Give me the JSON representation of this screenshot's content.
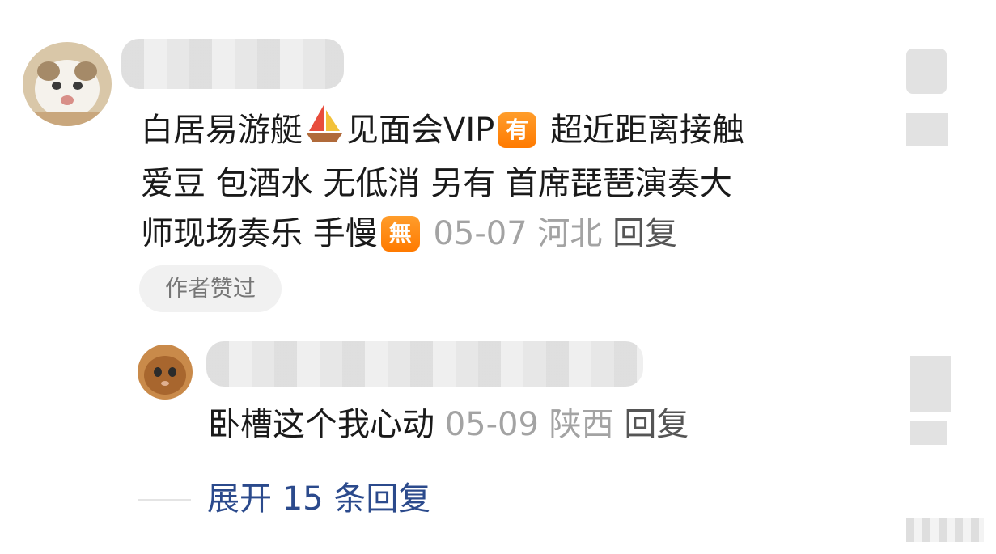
{
  "comment": {
    "segments_line1_a": "白居易游艇",
    "segments_line1_b": "见面会VIP",
    "badge_you": "有",
    "segments_line1_c": "  超近距离接触",
    "line2": "爱豆 包酒水 无低消  另有 首席琵琶演奏大",
    "line3": "师现场奏乐  手慢",
    "badge_wu": "無",
    "date": "05-07",
    "location": "河北",
    "reply_label": "回复",
    "author_liked": "作者赞过"
  },
  "reply": {
    "text": "卧槽这个我心动",
    "date": "05-09",
    "location": "陕西",
    "reply_label": "回复"
  },
  "expand_label": "展开 15 条回复",
  "colors": {
    "link": "#2b4a8c",
    "meta": "#a3a3a3",
    "badge": "#ff8a00"
  },
  "icons": [
    "sailboat-emoji",
    "you-badge",
    "wu-badge",
    "heart-icon"
  ]
}
